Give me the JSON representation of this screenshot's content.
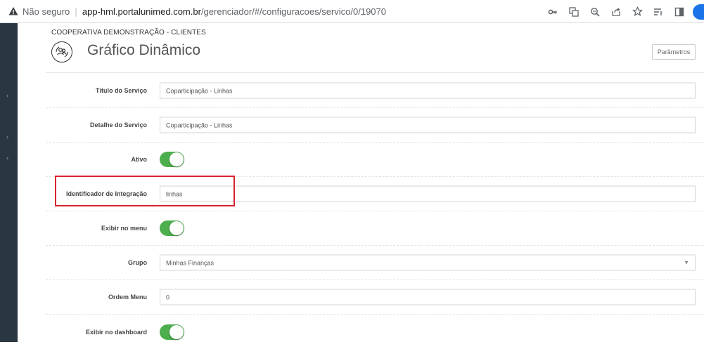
{
  "browser": {
    "security_label": "Não seguro",
    "url_host": "app-hml.portalunimed.com.br",
    "url_path": "/gerenciador/#/configuracoes/servico/0/19070"
  },
  "header": {
    "organization": "COOPERATIVA DEMONSTRAÇÃO - CLIENTES",
    "title": "Gráfico Dinâmico",
    "params_button": "Parâmetros"
  },
  "form": {
    "service_title": {
      "label": "Título do Serviço",
      "value": "Coparticipação - Linhas"
    },
    "service_detail": {
      "label": "Detalhe do Serviço",
      "value": "Coparticipação - Linhas"
    },
    "active": {
      "label": "Ativo",
      "on": true
    },
    "integration_id": {
      "label": "Identificador de Integração",
      "value": "linhas"
    },
    "show_in_menu": {
      "label": "Exibir no menu",
      "on": true
    },
    "group": {
      "label": "Grupo",
      "value": "Minhas Finanças"
    },
    "menu_order": {
      "label": "Ordem Menu",
      "value": "0"
    },
    "show_in_dashboard": {
      "label": "Exibir no dashboard",
      "on": true
    }
  },
  "colors": {
    "sidebar": "#2b3643",
    "toggle_on": "#4cae4c",
    "highlight": "#d9232e"
  }
}
